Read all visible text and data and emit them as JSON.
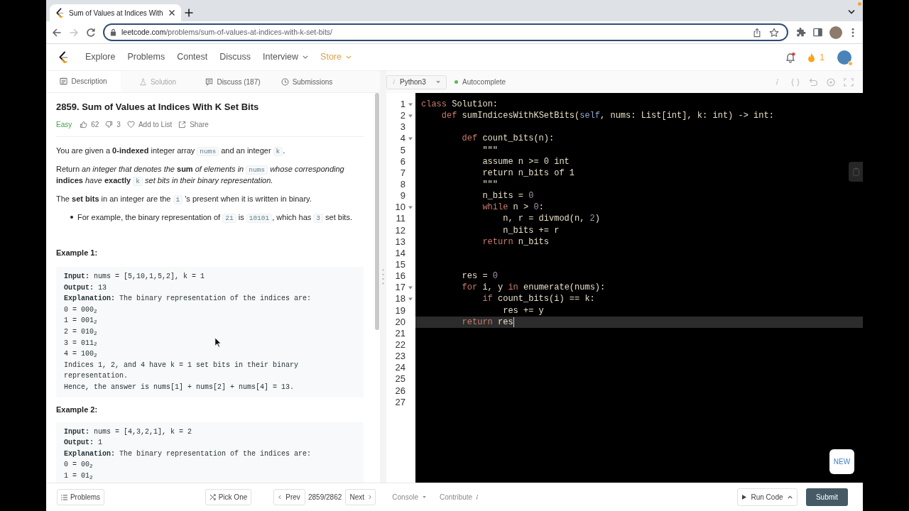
{
  "browser": {
    "tab_title": "Sum of Values at Indices With",
    "nav_buttons": [
      {
        "kind": "back",
        "disabled": false
      },
      {
        "kind": "forward",
        "disabled": true
      },
      {
        "kind": "reload",
        "disabled": false
      }
    ],
    "url": {
      "host": "leetcode.com",
      "path": "/problems/sum-of-values-at-indices-with-k-set-bits/"
    }
  },
  "site_nav": {
    "links": [
      {
        "label": "Explore",
        "kind": "link"
      },
      {
        "label": "Problems",
        "kind": "link"
      },
      {
        "label": "Contest",
        "kind": "link"
      },
      {
        "label": "Discuss",
        "kind": "link"
      },
      {
        "label": "Interview",
        "kind": "menu"
      },
      {
        "label": "Store",
        "kind": "store"
      }
    ],
    "notifications_unread": true,
    "streak": "1"
  },
  "problem_tabs": [
    {
      "label": "Description",
      "kind": "description",
      "selected": true,
      "disabled": false
    },
    {
      "label": "Solution",
      "kind": "solution",
      "selected": false,
      "disabled": true
    },
    {
      "label": "Discuss (187)",
      "kind": "discuss",
      "selected": false,
      "disabled": false
    },
    {
      "label": "Submissions",
      "kind": "submissions",
      "selected": false,
      "disabled": false
    }
  ],
  "problem": {
    "title": "2859. Sum of Values at Indices With K Set Bits",
    "difficulty": "Easy",
    "actions": [
      {
        "kind": "like",
        "label": "62"
      },
      {
        "kind": "dislike",
        "label": "3"
      },
      {
        "kind": "favorite",
        "label": "Add to List"
      },
      {
        "kind": "share",
        "label": "Share"
      }
    ],
    "paragraphs": [
      {
        "kind": "paragraph",
        "segments": [
          {
            "kind": "text",
            "text": "You are given a **0-indexed** integer array "
          },
          {
            "kind": "code",
            "text": "nums"
          },
          {
            "kind": "text",
            "text": " and an integer "
          },
          {
            "kind": "code",
            "text": "k"
          },
          {
            "kind": "text",
            "text": "."
          }
        ]
      },
      {
        "kind": "paragraph",
        "segments": [
          {
            "kind": "text",
            "text": "Return *an integer that denotes the* **sum** *of elements in* "
          },
          {
            "kind": "code",
            "text": "nums"
          },
          {
            "kind": "text",
            "text": " *whose corresponding* **indices** *have* **exactly** "
          },
          {
            "kind": "code",
            "text": "k"
          },
          {
            "kind": "text",
            "text": " *set bits in their binary representation.*"
          }
        ]
      },
      {
        "kind": "paragraph",
        "segments": [
          {
            "kind": "text",
            "text": "The **set bits** in an integer are the "
          },
          {
            "kind": "code",
            "text": "1"
          },
          {
            "kind": "text",
            "text": " 's present when it is written in binary."
          }
        ]
      },
      {
        "kind": "bullet",
        "segments": [
          {
            "kind": "text",
            "text": "For example, the binary representation of "
          },
          {
            "kind": "code",
            "text": "21"
          },
          {
            "kind": "text",
            "text": " is "
          },
          {
            "kind": "code",
            "text": "10101"
          },
          {
            "kind": "text",
            "text": ", which has "
          },
          {
            "kind": "code",
            "text": "3"
          },
          {
            "kind": "text",
            "text": " set bits."
          }
        ]
      }
    ],
    "examples": [
      {
        "heading": "Example 1:",
        "lines": [
          "**Input:** nums = [5,10,1,5,2], k = 1",
          "**Output:** 13",
          "**Explanation:** The binary representation of the indices are:",
          "0 = 000$_{2}$",
          "1 = 001$_{2}$",
          "2 = 010$_{2}$",
          "3 = 011$_{2}$",
          "4 = 100$_{2}$",
          "Indices 1, 2, and 4 have k = 1 set bits in their binary representation.",
          "Hence, the answer is nums[1] + nums[2] + nums[4] = 13."
        ]
      },
      {
        "heading": "Example 2:",
        "lines": [
          "**Input:** nums = [4,3,2,1], k = 2",
          "**Output:** 1",
          "**Explanation:** The binary representation of the indices are:",
          "0 = 00$_{2}$",
          "1 = 01$_{2}$"
        ]
      }
    ]
  },
  "editor": {
    "language": "Python3",
    "autocomplete": {
      "label": "Autocomplete",
      "on": true
    },
    "new_badge": "NEW",
    "lines": [
      {
        "number": "1",
        "fold": true,
        "current": false,
        "tokens": [
          {
            "kind": "keyword",
            "text": "class"
          },
          {
            "kind": "plain",
            "text": " Solution:"
          }
        ]
      },
      {
        "number": "2",
        "fold": true,
        "current": false,
        "tokens": [
          {
            "kind": "keyword",
            "text": "    def"
          },
          {
            "kind": "plain",
            "text": " sumIndicesWithKSetBits("
          },
          {
            "kind": "self",
            "text": "self"
          },
          {
            "kind": "plain",
            "text": ", nums: List[int], k: int) -> int:"
          }
        ]
      },
      {
        "number": "3",
        "fold": false,
        "current": false
      },
      {
        "number": "4",
        "fold": true,
        "current": false,
        "tokens": [
          {
            "kind": "keyword",
            "text": "        def"
          },
          {
            "kind": "plain",
            "text": " count_bits(n):"
          }
        ]
      },
      {
        "number": "5",
        "fold": false,
        "current": false,
        "tokens": [
          {
            "kind": "plain",
            "text": "            \"\"\""
          }
        ]
      },
      {
        "number": "6",
        "fold": false,
        "current": false,
        "tokens": [
          {
            "kind": "plain",
            "text": "            assume n >= 0 int"
          }
        ]
      },
      {
        "number": "7",
        "fold": false,
        "current": false,
        "tokens": [
          {
            "kind": "plain",
            "text": "            return n_bits of 1"
          }
        ]
      },
      {
        "number": "8",
        "fold": false,
        "current": false,
        "tokens": [
          {
            "kind": "plain",
            "text": "            \"\"\""
          }
        ]
      },
      {
        "number": "9",
        "fold": false,
        "current": false,
        "tokens": [
          {
            "kind": "plain",
            "text": "            n_bits = "
          },
          {
            "kind": "number",
            "text": "0"
          }
        ]
      },
      {
        "number": "10",
        "fold": true,
        "current": false,
        "tokens": [
          {
            "kind": "keyword",
            "text": "            while"
          },
          {
            "kind": "plain",
            "text": " n > "
          },
          {
            "kind": "number",
            "text": "0"
          },
          {
            "kind": "plain",
            "text": ":"
          }
        ]
      },
      {
        "number": "11",
        "fold": false,
        "current": false,
        "tokens": [
          {
            "kind": "plain",
            "text": "                n, r = divmod(n, "
          },
          {
            "kind": "number",
            "text": "2"
          },
          {
            "kind": "plain",
            "text": ")"
          }
        ]
      },
      {
        "number": "12",
        "fold": false,
        "current": false,
        "tokens": [
          {
            "kind": "plain",
            "text": "                n_bits += r"
          }
        ]
      },
      {
        "number": "13",
        "fold": false,
        "current": false,
        "tokens": [
          {
            "kind": "keyword",
            "text": "            return"
          },
          {
            "kind": "plain",
            "text": " n_bits"
          }
        ]
      },
      {
        "number": "14",
        "fold": false,
        "current": false
      },
      {
        "number": "15",
        "fold": false,
        "current": false
      },
      {
        "number": "16",
        "fold": false,
        "current": false,
        "tokens": [
          {
            "kind": "plain",
            "text": "        res = "
          },
          {
            "kind": "number",
            "text": "0"
          }
        ]
      },
      {
        "number": "17",
        "fold": true,
        "current": false,
        "tokens": [
          {
            "kind": "keyword",
            "text": "        for"
          },
          {
            "kind": "plain",
            "text": " i, y "
          },
          {
            "kind": "keyword",
            "text": "in"
          },
          {
            "kind": "plain",
            "text": " enumerate(nums):"
          }
        ]
      },
      {
        "number": "18",
        "fold": true,
        "current": false,
        "tokens": [
          {
            "kind": "keyword",
            "text": "            if"
          },
          {
            "kind": "plain",
            "text": " count_bits(i) == k:"
          }
        ]
      },
      {
        "number": "19",
        "fold": false,
        "current": false,
        "tokens": [
          {
            "kind": "plain",
            "text": "                res += y"
          }
        ]
      },
      {
        "number": "20",
        "fold": false,
        "current": true,
        "tokens": [
          {
            "kind": "keyword",
            "text": "        return"
          },
          {
            "kind": "plain",
            "text": " res"
          }
        ]
      },
      {
        "number": "21",
        "fold": false,
        "current": false
      },
      {
        "number": "22",
        "fold": false,
        "current": false
      },
      {
        "number": "23",
        "fold": false,
        "current": false
      },
      {
        "number": "24",
        "fold": false,
        "current": false
      },
      {
        "number": "25",
        "fold": false,
        "current": false
      },
      {
        "number": "26",
        "fold": false,
        "current": false
      },
      {
        "number": "27",
        "fold": false,
        "current": false
      }
    ]
  },
  "bottom_bar": {
    "problems": "Problems",
    "pick_one": "Pick One",
    "prev": "Prev",
    "counter": "2859/2862",
    "next": "Next",
    "console": "Console",
    "contribute": "Contribute",
    "run_code": "Run Code",
    "submit": "Submit"
  }
}
